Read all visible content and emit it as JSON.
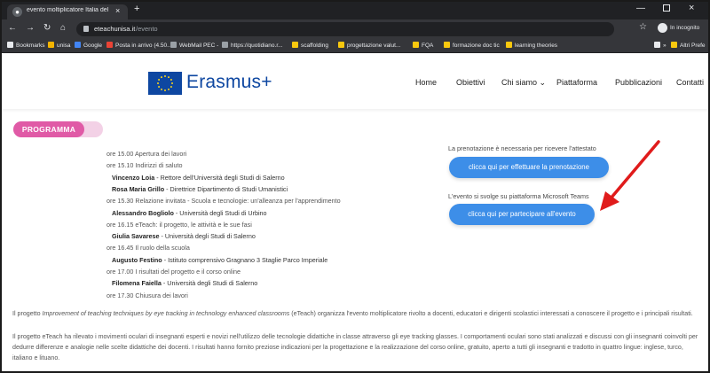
{
  "browser": {
    "tab_title": "evento moltiplicatore Italia del p",
    "tab_close": "×",
    "new_tab": "+",
    "url_host": "eteachunisa.it",
    "url_path": "/evento",
    "incognito_label": "In incognito",
    "bookmarks": [
      {
        "label": "Bookmarks",
        "color": "#e8eaed"
      },
      {
        "label": "unisa",
        "color": "#f4b400"
      },
      {
        "label": "Google",
        "color": "#4285f4"
      },
      {
        "label": "Posta in arrivo (4.50...",
        "color": "#ea4335"
      },
      {
        "label": "WebMail PEC -",
        "color": "#9aa0a6"
      },
      {
        "label": "https://quotidiano.r...",
        "color": "#9aa0a6"
      },
      {
        "label": "scaffolding",
        "color": "#f9c80e"
      },
      {
        "label": "progettazione valut...",
        "color": "#f9c80e"
      },
      {
        "label": "FQA",
        "color": "#f9c80e"
      },
      {
        "label": "formazione doc tic",
        "color": "#f9c80e"
      },
      {
        "label": "learning theories",
        "color": "#f9c80e"
      },
      {
        "label": "»",
        "color": "#e8eaed"
      },
      {
        "label": "Altri Prefe",
        "color": "#f9c80e"
      }
    ]
  },
  "site": {
    "logo_text": "Erasmus+",
    "brand_color": "#0e47a1",
    "nav": [
      "Home",
      "Obiettivi",
      "Chi siamo ⌄",
      "Piattaforma",
      "Pubblicazioni",
      "Contatti"
    ]
  },
  "program": {
    "heading": "PROGRAMMA",
    "lines": [
      {
        "time": "ore 15.00",
        "text": "Apertura dei lavori"
      },
      {
        "time": "ore 15.10",
        "text": "Indirizzi di saluto"
      },
      {
        "name": "Vincenzo Loia",
        "role": " - Rettore dell'Università degli Studi di Salerno"
      },
      {
        "name": "Rosa Maria Grillo",
        "role": " - Direttrice Dipartimento di Studi Umanistici"
      },
      {
        "time": "ore 15.30",
        "text": "Relazione invitata - Scuola e tecnologie: un'alleanza per l'apprendimento"
      },
      {
        "name": "Alessandro Bogliolo",
        "role": " - Università degli Studi di Urbino"
      },
      {
        "time": "ore 16.15",
        "text": "eTeach: il progetto, le attività e le sue fasi"
      },
      {
        "name": "Giulia Savarese",
        "role": " - Università degli Studi di Salerno"
      },
      {
        "time": "ore 16.45",
        "text": "Il ruolo della scuola"
      },
      {
        "name": "Augusto Festino",
        "role": " - Istituto comprensivo Gragnano 3 Staglie Parco Imperiale"
      },
      {
        "time": "ore 17.00",
        "text": "I risultati del progetto e il corso online"
      },
      {
        "name": "Filomena Faiella",
        "role": " - Università degli Studi di Salerno"
      },
      {
        "time": "ore 17.30",
        "text": "Chiusura dei lavori"
      }
    ]
  },
  "booking": {
    "note": "La prenotazione è necessaria per ricevere l'attestato",
    "button": "clicca qui per effettuare la prenotazione"
  },
  "event": {
    "note": "L'evento si svolge su piattaforma Microsoft Teams",
    "button": "clicca qui per partecipare all'evento",
    "accent_color": "#3d8ee8",
    "annotation_color": "#e01b1b"
  },
  "description": {
    "p1_pre": "Il progetto ",
    "p1_em": "Improvement of teaching techniques by eye tracking in technology enhanced classrooms",
    "p1_post": " (eTeach) organizza l'evento moltiplicatore rivolto a docenti, educatori e dirigenti scolastici interessati a conoscere il progetto e i principali risultati.",
    "p2": "Il progetto eTeach ha rilevato i movimenti oculari di insegnanti esperti e novizi nell'utilizzo delle tecnologie didattiche in classe attraverso gli eye tracking glasses. I comportamenti oculari sono stati analizzati e discussi con gli insegnanti coinvolti per dedurre differenze e analogie nelle scelte didattiche dei docenti. I risultati hanno fornito preziose indicazioni per la progettazione e la realizzazione del corso online, gratuito, aperto a tutti gli insegnanti e tradotto in quattro lingue: inglese, turco, italiano e lituano."
  }
}
